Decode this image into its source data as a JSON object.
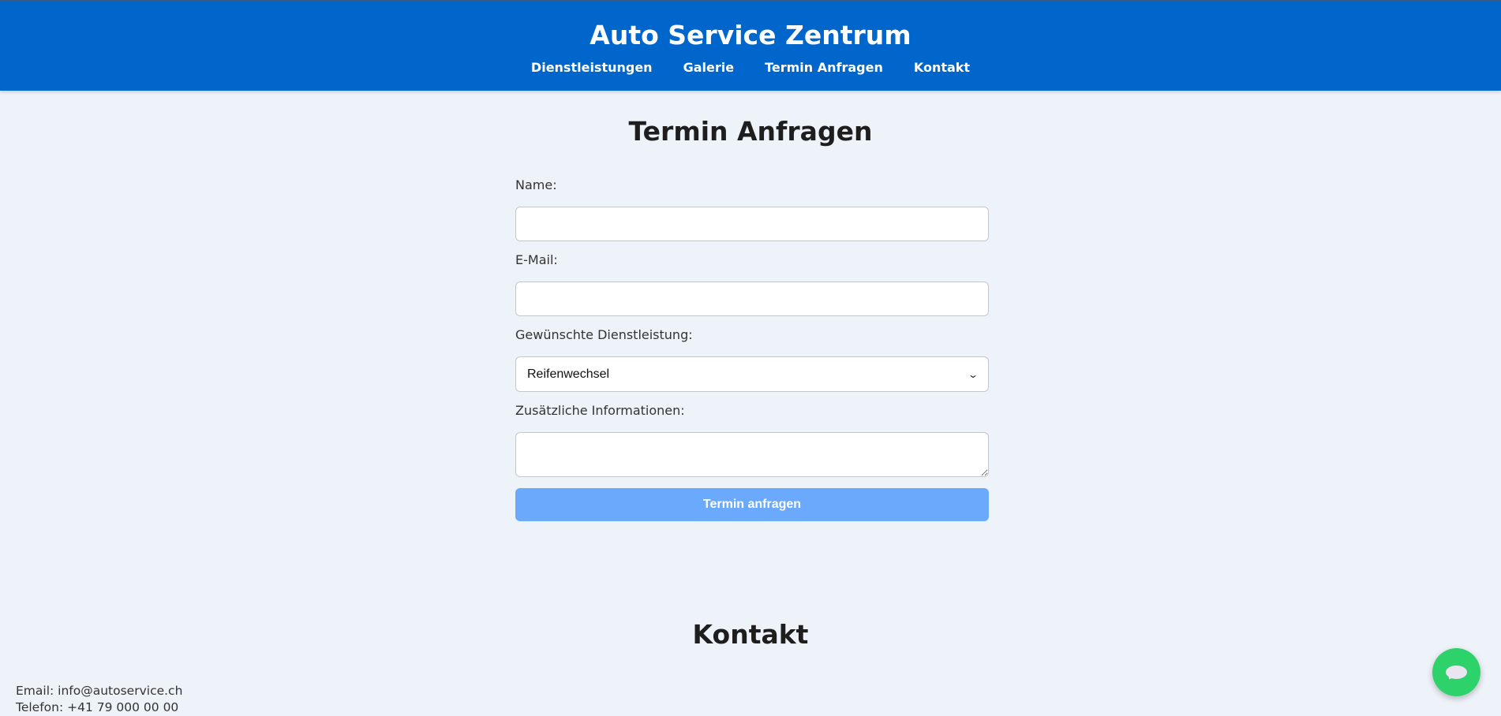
{
  "header": {
    "title": "Auto Service Zentrum",
    "nav": [
      {
        "label": "Dienstleistungen"
      },
      {
        "label": "Galerie"
      },
      {
        "label": "Termin Anfragen"
      },
      {
        "label": "Kontakt"
      }
    ]
  },
  "appointment": {
    "title": "Termin Anfragen",
    "name_label": "Name:",
    "name_value": "",
    "email_label": "E-Mail:",
    "email_value": "",
    "service_label": "Gewünschte Dienstleistung:",
    "service_selected": "Reifenwechsel",
    "info_label": "Zusätzliche Informationen:",
    "info_value": "",
    "submit_label": "Termin anfragen"
  },
  "contact": {
    "title": "Kontakt",
    "email_line": "Email: info@autoservice.ch",
    "phone_line": "Telefon: +41 79 000 00 00"
  },
  "chat": {
    "icon": "chat-bubble-icon"
  },
  "colors": {
    "header_bg": "#0166cc",
    "page_bg": "#eef3f9",
    "submit_bg": "#6aa9fb",
    "chat_bg": "#2dd36a"
  }
}
